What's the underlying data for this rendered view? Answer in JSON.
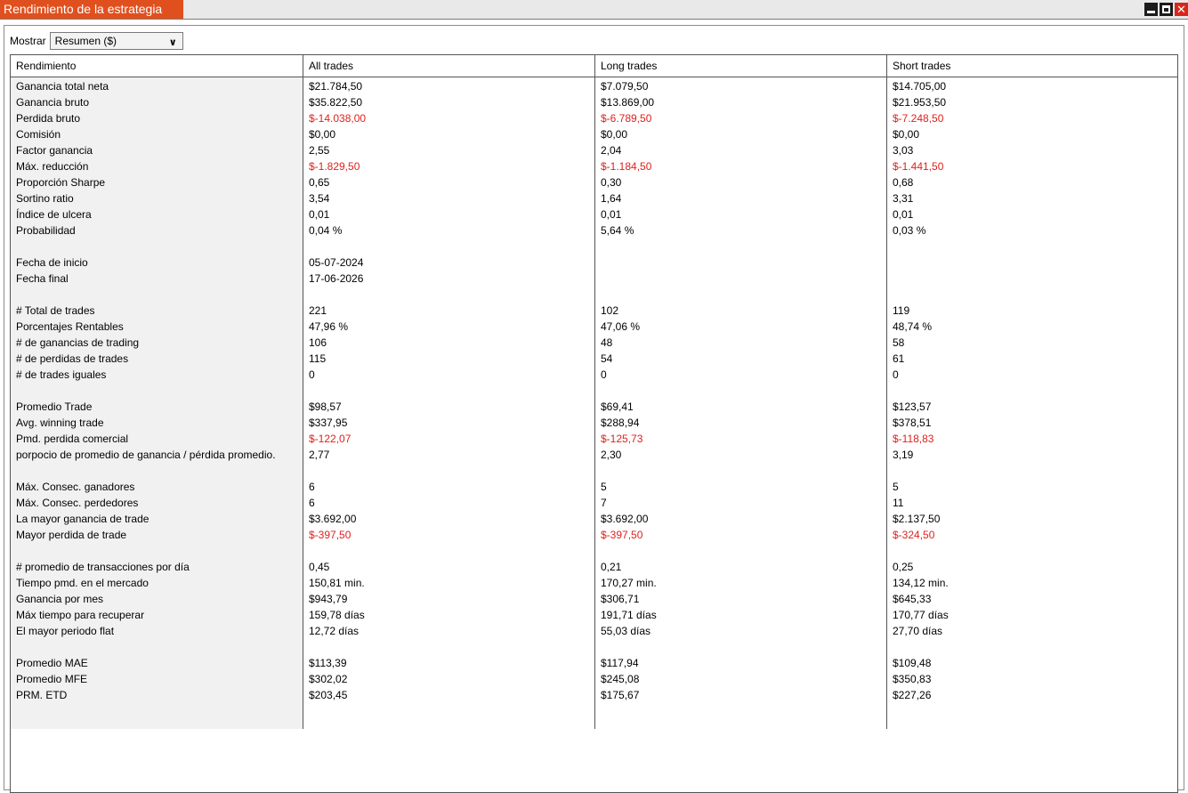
{
  "window": {
    "title": "Rendimiento de la estrategia",
    "controls": {
      "close_glyph": "✕"
    }
  },
  "toolbar": {
    "show_label": "Mostrar",
    "select_value": "Resumen ($)"
  },
  "table": {
    "headers": [
      "Rendimiento",
      "All trades",
      "Long trades",
      "Short trades"
    ],
    "rows": [
      [
        "Ganancia total neta",
        "$21.784,50",
        "$7.079,50",
        "$14.705,00"
      ],
      [
        "Ganancia bruto",
        "$35.822,50",
        "$13.869,00",
        "$21.953,50"
      ],
      [
        "Perdida bruto",
        "$-14.038,00",
        "$-6.789,50",
        "$-7.248,50"
      ],
      [
        "Comisión",
        "$0,00",
        "$0,00",
        "$0,00"
      ],
      [
        "Factor ganancia",
        "2,55",
        "2,04",
        "3,03"
      ],
      [
        "Máx. reducción",
        "$-1.829,50",
        "$-1.184,50",
        "$-1.441,50"
      ],
      [
        "Proporción Sharpe",
        "0,65",
        "0,30",
        "0,68"
      ],
      [
        "Sortino ratio",
        "3,54",
        "1,64",
        "3,31"
      ],
      [
        "Índice de ulcera",
        "0,01",
        "0,01",
        "0,01"
      ],
      [
        "Probabilidad",
        "0,04 %",
        "5,64 %",
        "0,03 %"
      ],
      [
        "",
        "",
        "",
        ""
      ],
      [
        "Fecha de inicio",
        "05-07-2024",
        "",
        ""
      ],
      [
        "Fecha final",
        "17-06-2026",
        "",
        ""
      ],
      [
        "",
        "",
        "",
        ""
      ],
      [
        "# Total de trades",
        "221",
        "102",
        "119"
      ],
      [
        "Porcentajes Rentables",
        "47,96 %",
        "47,06 %",
        "48,74 %"
      ],
      [
        "# de ganancias de trading",
        "106",
        "48",
        "58"
      ],
      [
        "# de perdidas de trades",
        "115",
        "54",
        "61"
      ],
      [
        "# de trades iguales",
        "0",
        "0",
        "0"
      ],
      [
        "",
        "",
        "",
        ""
      ],
      [
        "Promedio Trade",
        "$98,57",
        "$69,41",
        "$123,57"
      ],
      [
        "Avg. winning trade",
        "$337,95",
        "$288,94",
        "$378,51"
      ],
      [
        "Pmd. perdida comercial",
        "$-122,07",
        "$-125,73",
        "$-118,83"
      ],
      [
        "porpocio de promedio de ganancia / pérdida promedio.",
        "2,77",
        "2,30",
        "3,19"
      ],
      [
        "",
        "",
        "",
        ""
      ],
      [
        "Máx. Consec. ganadores",
        "6",
        "5",
        "5"
      ],
      [
        "Máx. Consec. perdedores",
        "6",
        "7",
        "11"
      ],
      [
        "La mayor ganancia de trade",
        "$3.692,00",
        "$3.692,00",
        "$2.137,50"
      ],
      [
        "Mayor perdida de trade",
        "$-397,50",
        "$-397,50",
        "$-324,50"
      ],
      [
        "",
        "",
        "",
        ""
      ],
      [
        "# promedio de transacciones por día",
        "0,45",
        "0,21",
        "0,25"
      ],
      [
        "Tiempo pmd. en el mercado",
        "150,81 min.",
        "170,27 min.",
        "134,12 min."
      ],
      [
        "Ganancia por mes",
        "$943,79",
        "$306,71",
        "$645,33"
      ],
      [
        "Máx tiempo para recuperar",
        "159,78 días",
        "191,71 días",
        "170,77 días"
      ],
      [
        "El mayor periodo flat",
        "12,72 días",
        "55,03 días",
        "27,70 días"
      ],
      [
        "",
        "",
        "",
        ""
      ],
      [
        "Promedio MAE",
        "$113,39",
        "$117,94",
        "$109,48"
      ],
      [
        "Promedio MFE",
        "$302,02",
        "$245,08",
        "$350,83"
      ],
      [
        "PRM. ETD",
        "$203,45",
        "$175,67",
        "$227,26"
      ]
    ]
  },
  "colors": {
    "title_accent": "#e0501f",
    "negative_value": "#e0201b",
    "label_column_bg": "#f1f1f1"
  }
}
